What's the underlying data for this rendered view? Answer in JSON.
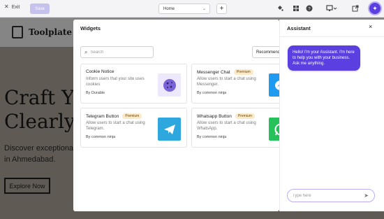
{
  "toolbar": {
    "exit_label": "Exit",
    "save_label": "Save",
    "page_select": "Home",
    "add_label": "+",
    "icons": [
      "paint-bucket-icon",
      "grid-icon",
      "help-icon",
      "desktop-icon",
      "external-link-icon",
      "ai-assistant-icon"
    ]
  },
  "site": {
    "brand": "Toolplate",
    "hero_heading_lines": [
      "Craft Y",
      "Clearly"
    ],
    "hero_text_lines": [
      "Discover exceptional",
      "in Ahmedabad."
    ],
    "hero_button": "Explore Now"
  },
  "widgets": {
    "title": "Widgets",
    "search_placeholder": "Search",
    "sort_label": "Recommend",
    "cards": [
      {
        "title": "Cookie Notice",
        "badge": "",
        "desc": "Inform users that your site uses cookies",
        "by": "By Durable",
        "icon": "cookie-icon",
        "color": "#ede8fb"
      },
      {
        "title": "Messenger Chat",
        "badge": "Premium",
        "desc": "Allow users to start a chat using Messenger.",
        "by": "By common ninja",
        "icon": "messenger-icon",
        "color": "#1e9bf0"
      },
      {
        "title": "Telegram Button",
        "badge": "Premium",
        "desc": "Allow users to start a chat using Telegram.",
        "by": "By common ninja",
        "icon": "telegram-icon",
        "color": "#2ea6de"
      },
      {
        "title": "Whatsapp Button",
        "badge": "Premium",
        "desc": "Allow users to start a chat using WhatsApp.",
        "by": "By common ninja",
        "icon": "whatsapp-icon",
        "color": "#25c15a"
      }
    ]
  },
  "assistant": {
    "title": "Assistant",
    "close": "×",
    "message": "Hello! I'm your Assistant. I'm here to help you with your business. Ask me anything.",
    "input_placeholder": "Type here"
  },
  "colors": {
    "accent": "#5b3fe0",
    "badge_bg": "#fbe9c7"
  }
}
